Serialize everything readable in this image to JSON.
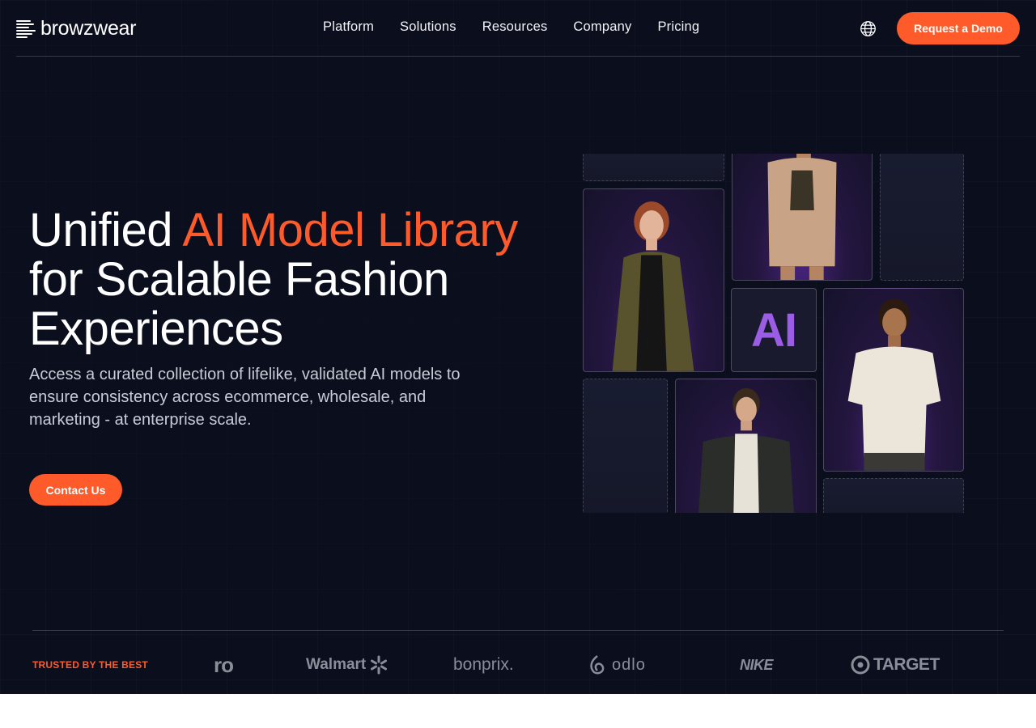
{
  "nav": {
    "logo_text": "browzwear",
    "items": [
      {
        "label": "Platform"
      },
      {
        "label": "Solutions"
      },
      {
        "label": "Resources"
      },
      {
        "label": "Company"
      },
      {
        "label": "Pricing"
      }
    ],
    "demo_label": "Request a Demo"
  },
  "hero": {
    "headline_pre": "Unified ",
    "headline_accent": "AI Model Library",
    "headline_post": "for Scalable Fashion Experiences",
    "subtitle": "Access a curated collection of lifelike, validated AI models to ensure consistency across ecommerce, wholesale, and marketing - at enterprise scale.",
    "cta_label": "Contact Us",
    "ai_tile_text": "AI"
  },
  "trusted": {
    "label": "TRUSTED BY THE BEST",
    "brands": [
      "ro",
      "Walmart",
      "bonprix.",
      "odlo",
      "NIKE",
      "TARGET"
    ]
  },
  "colors": {
    "accent": "#ff5a2a",
    "background": "#0b0f1d",
    "ai_purple": "#9b5de5"
  }
}
